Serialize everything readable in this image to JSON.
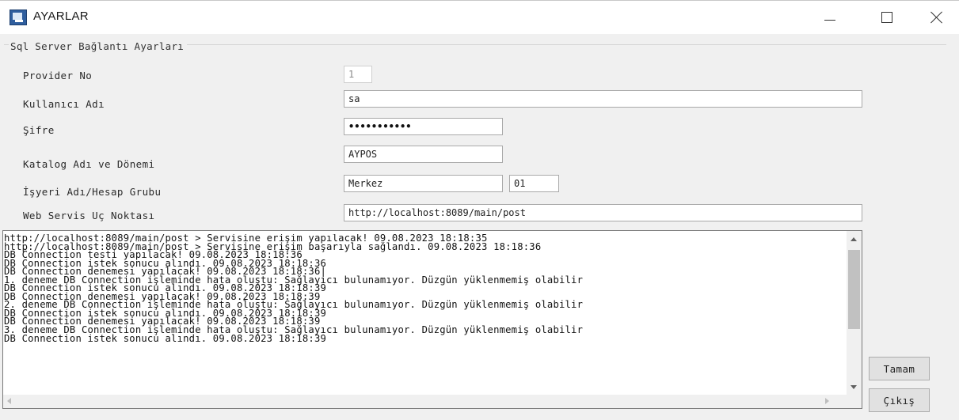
{
  "window": {
    "title": "AYARLAR"
  },
  "groupbox": {
    "legend": "Sql Server Bağlantı Ayarları"
  },
  "form": {
    "provider_label": "Provider No",
    "provider_value": "1",
    "user_label": "Kullanıcı Adı",
    "user_value": "sa",
    "password_label": "Şifre",
    "password_value": "•••••••••••",
    "catalog_label": "Katalog Adı ve Dönemi",
    "catalog_value": "AYPOS",
    "workplace_label": "İşyeri Adı/Hesap Grubu",
    "workplace_value": "Merkez",
    "account_group_value": "01",
    "webservice_label": "Web Servis Uç Noktası",
    "webservice_value": "http://localhost:8089/main/post"
  },
  "log": {
    "lines": [
      "http://localhost:8089/main/post > Servisine erişim yapılacak! 09.08.2023 18:18:35",
      "http://localhost:8089/main/post > Servisine erişim başarıyla sağlandı. 09.08.2023 18:18:36",
      "DB Connection testi yapılacak! 09.08.2023 18:18:36",
      "DB Connection istek sonucu alındı. 09.08.2023 18:18:36",
      "DB Connection denemesi yapılacak! 09.08.2023 18:18:36|",
      "1. deneme DB Connection işleminde hata oluştu: Sağlayıcı bulunamıyor. Düzgün yüklenmemiş olabilir",
      "DB Connection istek sonucu alındı. 09.08.2023 18:18:39",
      "DB Connection denemesi yapılacak! 09.08.2023 18:18:39",
      "2. deneme DB Connection işleminde hata oluştu: Sağlayıcı bulunamıyor. Düzgün yüklenmemiş olabilir",
      "DB Connection istek sonucu alındı. 09.08.2023 18:18:39",
      "DB Connection denemesi yapılacak! 09.08.2023 18:18:39",
      "3. deneme DB Connection işleminde hata oluştu: Sağlayıcı bulunamıyor. Düzgün yüklenmemiş olabilir",
      "DB Connection istek sonucu alındı. 09.08.2023 18:18:39"
    ]
  },
  "buttons": {
    "ok_label": "Tamam",
    "exit_label": "Çıkış"
  }
}
